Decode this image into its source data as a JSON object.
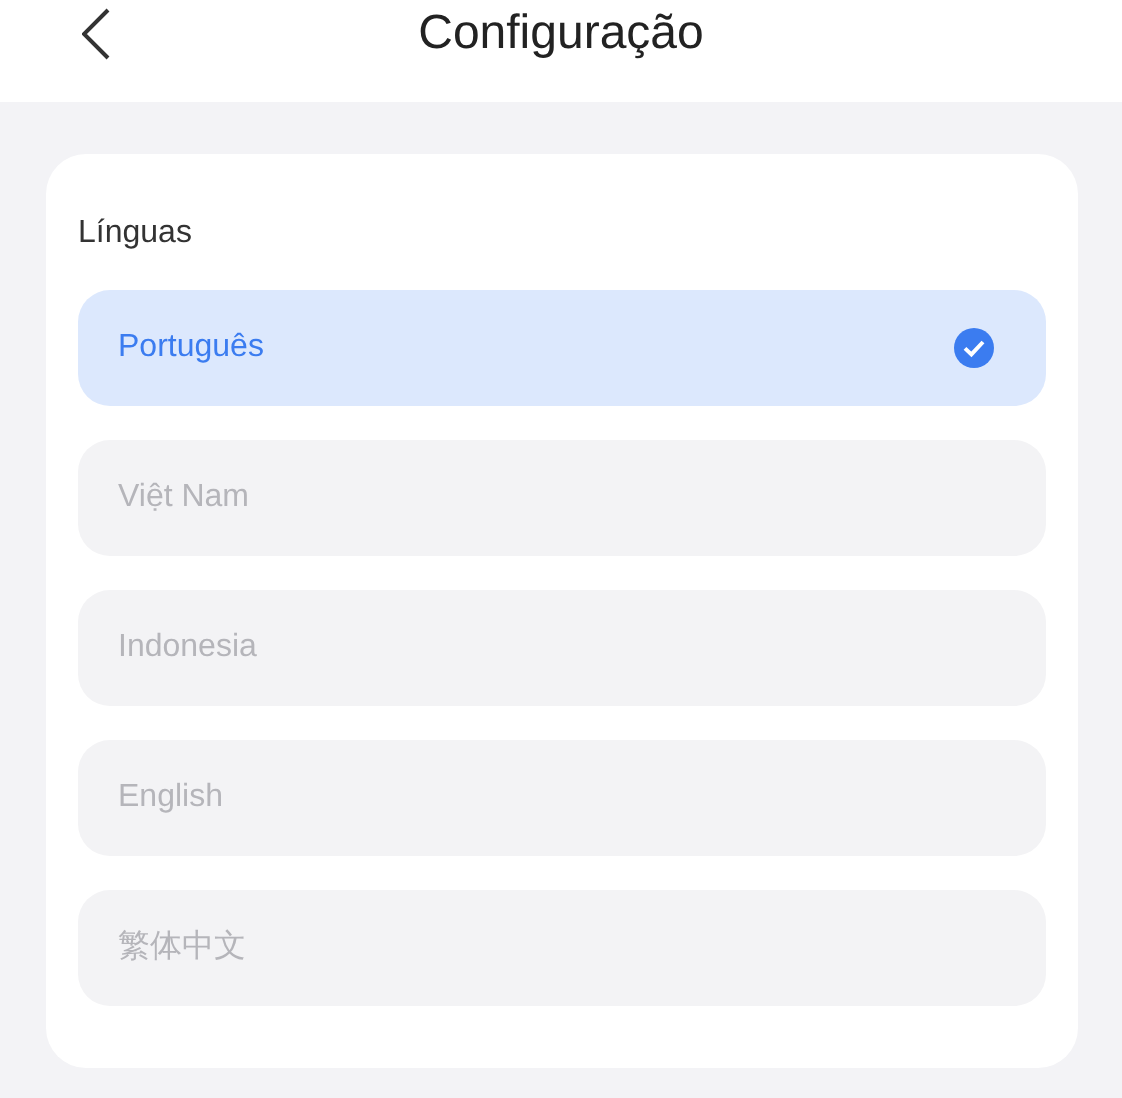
{
  "header": {
    "title": "Configuração"
  },
  "languages": {
    "label": "Línguas",
    "options": [
      {
        "label": "Português",
        "selected": true
      },
      {
        "label": "Việt Nam",
        "selected": false
      },
      {
        "label": "Indonesia",
        "selected": false
      },
      {
        "label": "English",
        "selected": false
      },
      {
        "label": "繁体中文",
        "selected": false
      }
    ]
  }
}
